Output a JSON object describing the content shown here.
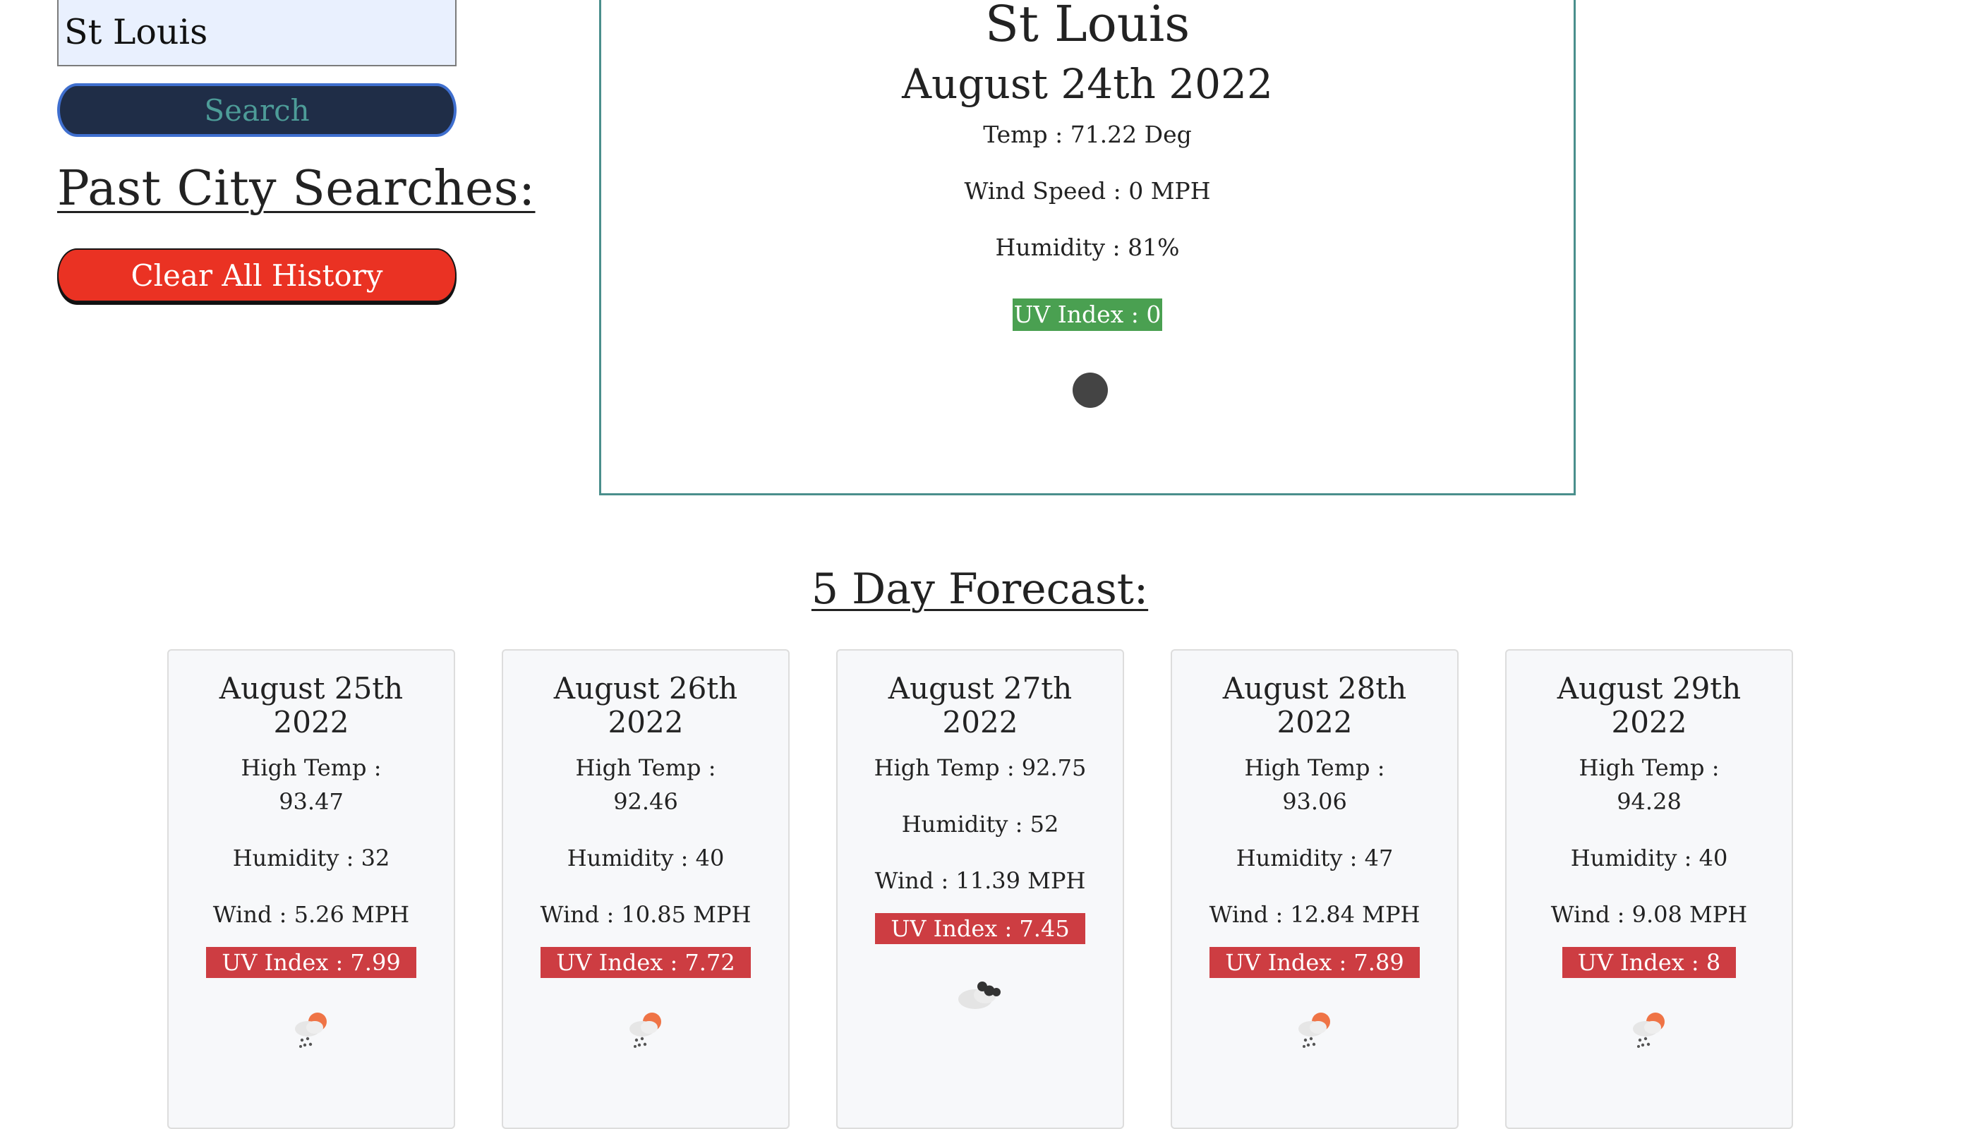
{
  "search": {
    "city_value": "St Louis",
    "button_label": "Search"
  },
  "history": {
    "title": "Past City Searches:",
    "clear_label": "Clear All History"
  },
  "current": {
    "city": "St Louis",
    "date": "August 24th 2022",
    "temp": "Temp : 71.22 Deg",
    "wind": "Wind Speed : 0 MPH",
    "humidity": "Humidity : 81%",
    "uv": "UV Index : 0",
    "uv_color": "#4aa051",
    "icon": "dark-circle-icon"
  },
  "forecast": {
    "title": "5 Day Forecast:",
    "uv_color": "#cd3d42",
    "days": [
      {
        "date": "August 25th 2022",
        "high": "High Temp : 93.47",
        "humidity": "Humidity : 32",
        "wind": "Wind : 5.26 MPH",
        "uv": "UV Index : 7.99",
        "icon": "rain-sun-icon"
      },
      {
        "date": "August 26th 2022",
        "high": "High Temp : 92.46",
        "humidity": "Humidity : 40",
        "wind": "Wind : 10.85 MPH",
        "uv": "UV Index : 7.72",
        "icon": "rain-sun-icon"
      },
      {
        "date": "August 27th 2022",
        "high": "High Temp : 92.75",
        "humidity": "Humidity : 52",
        "wind": "Wind : 11.39 MPH",
        "uv": "UV Index : 7.45",
        "icon": "cloud-icon"
      },
      {
        "date": "August 28th 2022",
        "high": "High Temp : 93.06",
        "humidity": "Humidity : 47",
        "wind": "Wind : 12.84 MPH",
        "uv": "UV Index : 7.89",
        "icon": "rain-sun-icon"
      },
      {
        "date": "August 29th 2022",
        "high": "High Temp : 94.28",
        "humidity": "Humidity : 40",
        "wind": "Wind : 9.08 MPH",
        "uv": "UV Index : 8",
        "icon": "rain-sun-icon"
      }
    ]
  }
}
